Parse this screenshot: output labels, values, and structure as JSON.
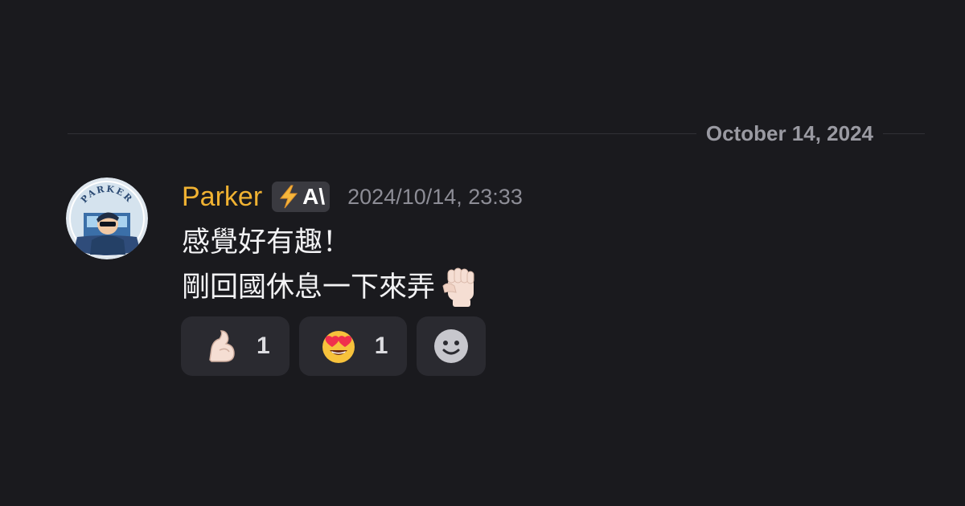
{
  "date_divider": {
    "label": "October 14, 2024"
  },
  "message": {
    "author": "Parker",
    "author_color": "#f0b232",
    "badge": {
      "icon": "lightning-bolt-icon",
      "text": "A\\"
    },
    "timestamp": "2024/10/14, 23:33",
    "lines": [
      "感覺好有趣！",
      "剛回國休息一下來弄"
    ],
    "trailing_emoji": "raised-fist-icon",
    "avatar": {
      "icon": "avatar-parker-logo",
      "ring_text": "PARKER"
    }
  },
  "reactions": [
    {
      "emoji": "flexed-biceps-icon",
      "count": "1"
    },
    {
      "emoji": "heart-eyes-icon",
      "count": "1"
    },
    {
      "emoji": "add-reaction-icon",
      "count": null
    }
  ],
  "colors": {
    "background": "#1a1a1e",
    "reaction_bg": "#2a2a30",
    "badge_bg": "#3a3a40",
    "timestamp": "#8d8d96"
  }
}
